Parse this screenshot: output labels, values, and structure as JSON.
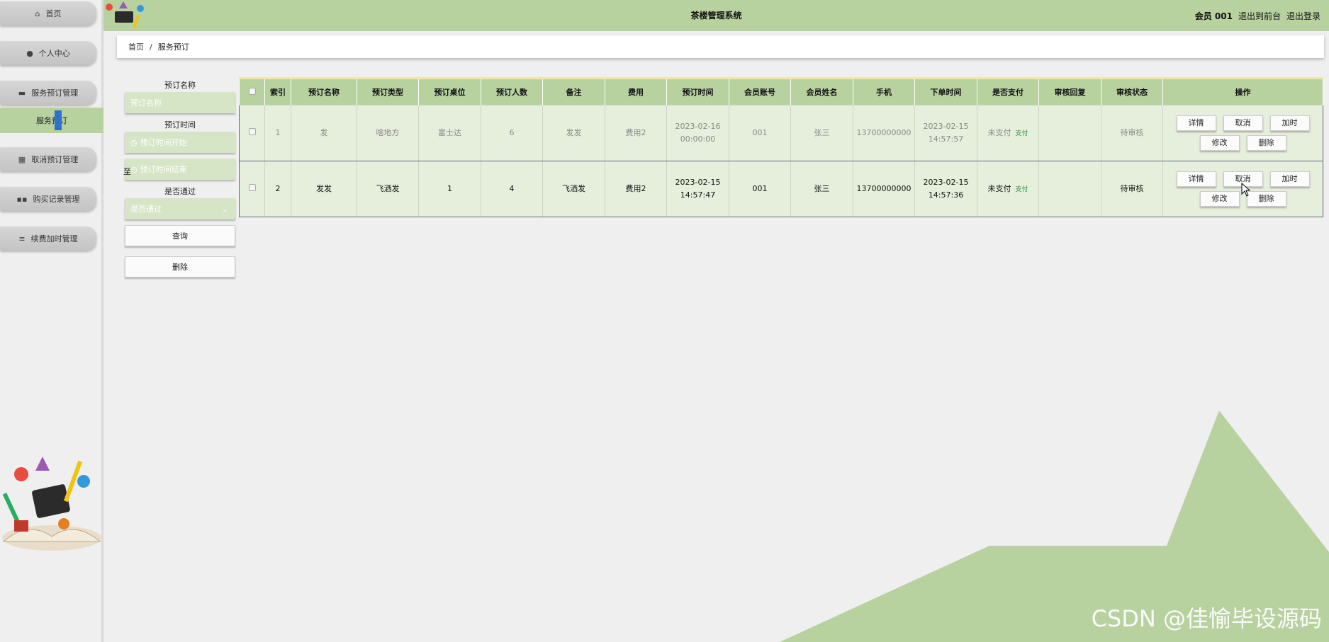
{
  "app": {
    "title": "茶楼管理系统"
  },
  "header": {
    "user_label": "会员 001",
    "front_link": "退出到前台",
    "logout_link": "退出登录"
  },
  "sidebar": {
    "items": [
      {
        "label": "首页",
        "icon": "home-icon"
      },
      {
        "label": "个人中心",
        "icon": "user-icon"
      },
      {
        "label": "服务预订管理",
        "icon": "monitor-icon"
      },
      {
        "label": "取消预订管理",
        "icon": "grid-icon"
      },
      {
        "label": "购买记录管理",
        "icon": "apps-icon"
      },
      {
        "label": "续费加时管理",
        "icon": "list-icon"
      }
    ],
    "sub_item": "服务预订"
  },
  "breadcrumb": {
    "home": "首页",
    "sep": "/",
    "current": "服务预订"
  },
  "search": {
    "name_label": "预订名称",
    "name_placeholder": "预订名称",
    "time_label": "预订时间",
    "time_start_placeholder": "预订时间开始",
    "to_label": "至",
    "time_end_placeholder": "预订时间结束",
    "passed_label": "是否通过",
    "passed_placeholder": "是否通过",
    "query_button": "查询",
    "delete_button": "删除"
  },
  "table": {
    "headers": [
      "索引",
      "预订名称",
      "预订类型",
      "预订桌位",
      "预订人数",
      "备注",
      "费用",
      "预订时间",
      "会员账号",
      "会员姓名",
      "手机",
      "下单时间",
      "是否支付",
      "审核回复",
      "审核状态",
      "操作"
    ],
    "rows": [
      {
        "index": "1",
        "name": "发",
        "type": "啥地方",
        "table_no": "富士达",
        "people": "6",
        "remark": "发发",
        "fee": "费用2",
        "book_time": "2023-02-16 00:00:00",
        "account": "001",
        "member_name": "张三",
        "phone": "13700000000",
        "order_time": "2023-02-15 14:57:57",
        "paid": "未支付",
        "pay_link": "支付",
        "review_reply": "",
        "review_status": "待审核"
      },
      {
        "index": "2",
        "name": "发发",
        "type": "飞洒发",
        "table_no": "1",
        "people": "4",
        "remark": "飞洒发",
        "fee": "费用2",
        "book_time": "2023-02-15 14:57:47",
        "account": "001",
        "member_name": "张三",
        "phone": "13700000000",
        "order_time": "2023-02-15 14:57:36",
        "paid": "未支付",
        "pay_link": "支付",
        "review_reply": "",
        "review_status": "待审核"
      }
    ],
    "ops": {
      "detail": "详情",
      "cancel": "取消",
      "extend": "加时",
      "edit": "修改",
      "delete": "删除"
    }
  },
  "watermark": "CSDN @佳愉毕设源码",
  "colors": {
    "accent": "#b7d19f",
    "row_bg": "#e6eedc",
    "sidebar_bg": "#efefef"
  }
}
